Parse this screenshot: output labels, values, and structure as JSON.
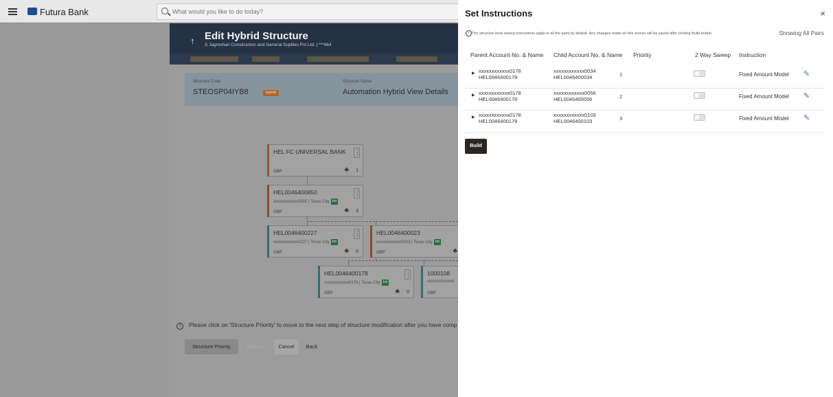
{
  "topbar": {
    "brand": "Futura Bank",
    "search_placeholder": "What would you like to do today?"
  },
  "page": {
    "title": "Edit Hybrid Structure",
    "subtitle": "S Jagmohan Construction and General Supllies Pvt Ltd. | ***464",
    "structure_code_label": "Structure Code",
    "structure_code": "STEOSP04IYB8",
    "hybrid_tag": "hybrid",
    "structure_name_label": "Structure Name",
    "structure_name": "Automation Hybrid View Details"
  },
  "tree": {
    "nodes": [
      {
        "title": "HEL FC UNIVERSAL BANK",
        "sub": "",
        "int": "",
        "ccy": "GBP",
        "count": "1",
        "accent": "#8a5a3a"
      },
      {
        "title": "HEL0046400850",
        "sub": "xxxxxxxxxxxx0850 | Texas City",
        "int": "Int",
        "ccy": "GBP",
        "count": "3",
        "accent": "#8a4a2e"
      },
      {
        "title": "HEL0046400227",
        "sub": "xxxxxxxxxxxx0227 | Texas City",
        "int": "Int",
        "ccy": "GBP",
        "count": "0",
        "accent": "#3d6a6e"
      },
      {
        "title": "HEL0046400023",
        "sub": "xxxxxxxxxxxx0023 | Texas City",
        "int": "Int",
        "ccy": "GBP",
        "count": "",
        "accent": "#8a4a2e"
      },
      {
        "title": "HEL0046400178",
        "sub": "xxxxxxxxxxxx0178 | Texas City",
        "int": "Int",
        "ccy": "GBP",
        "count": "0",
        "accent": "#3d6a6e"
      },
      {
        "title": "1000108",
        "sub": "xxxxxxxxxxxx0",
        "int": "",
        "ccy": "GBP",
        "count": "",
        "accent": "#3d6a6e"
      }
    ]
  },
  "footer": {
    "info": "Please click on 'Structure Priority' to move to the next step of structure modification after you have comp",
    "buttons": [
      "Structure Priority",
      "Submit",
      "Cancel",
      "Back"
    ]
  },
  "drawer": {
    "title": "Set Instructions",
    "info": "The structure level sweep instructions apply to all the pairs by default. Any changes made on this screen will be saved after clicking Build button.",
    "showing": "Showing All Pairs",
    "columns": [
      "Parent Account No. & Name",
      "Child Account No. & Name",
      "Priority",
      "2 Way Sweep",
      "Instruction"
    ],
    "rows": [
      {
        "parent_acc": "xxxxxxxxxxxx0178",
        "parent_name": "HEL0046400178",
        "child_acc": "xxxxxxxxxxxx0034",
        "child_name": "HEL0046400034",
        "priority": "1",
        "two_way": false,
        "instruction": "Fixed Amount Model"
      },
      {
        "parent_acc": "xxxxxxxxxxxx0178",
        "parent_name": "HEL0046400178",
        "child_acc": "xxxxxxxxxxxx0056",
        "child_name": "HEL0046400056",
        "priority": "2",
        "two_way": false,
        "instruction": "Fixed Amount Model"
      },
      {
        "parent_acc": "xxxxxxxxxxxx0178",
        "parent_name": "HEL0046400178",
        "child_acc": "xxxxxxxxxxxx0103",
        "child_name": "HEL0046400103",
        "priority": "3",
        "two_way": false,
        "instruction": "Fixed Amount Model"
      }
    ],
    "build_label": "Build"
  },
  "icons": {
    "menu": "hamburger-icon",
    "logo": "bank-logo-icon",
    "search": "search-icon",
    "back": "arrow-up-icon",
    "node_menu": "kebab-icon",
    "hierarchy": "hierarchy-icon",
    "info": "info-icon",
    "close": "close-icon",
    "edit": "pencil-icon",
    "expand": "caret-right-icon"
  },
  "colors": {
    "header": "#253246",
    "hybrid_tag": "#b0662d",
    "int_tag": "#2d6b3b",
    "build_button": "#2b2622",
    "edit_icon": "#4a6bb0"
  }
}
